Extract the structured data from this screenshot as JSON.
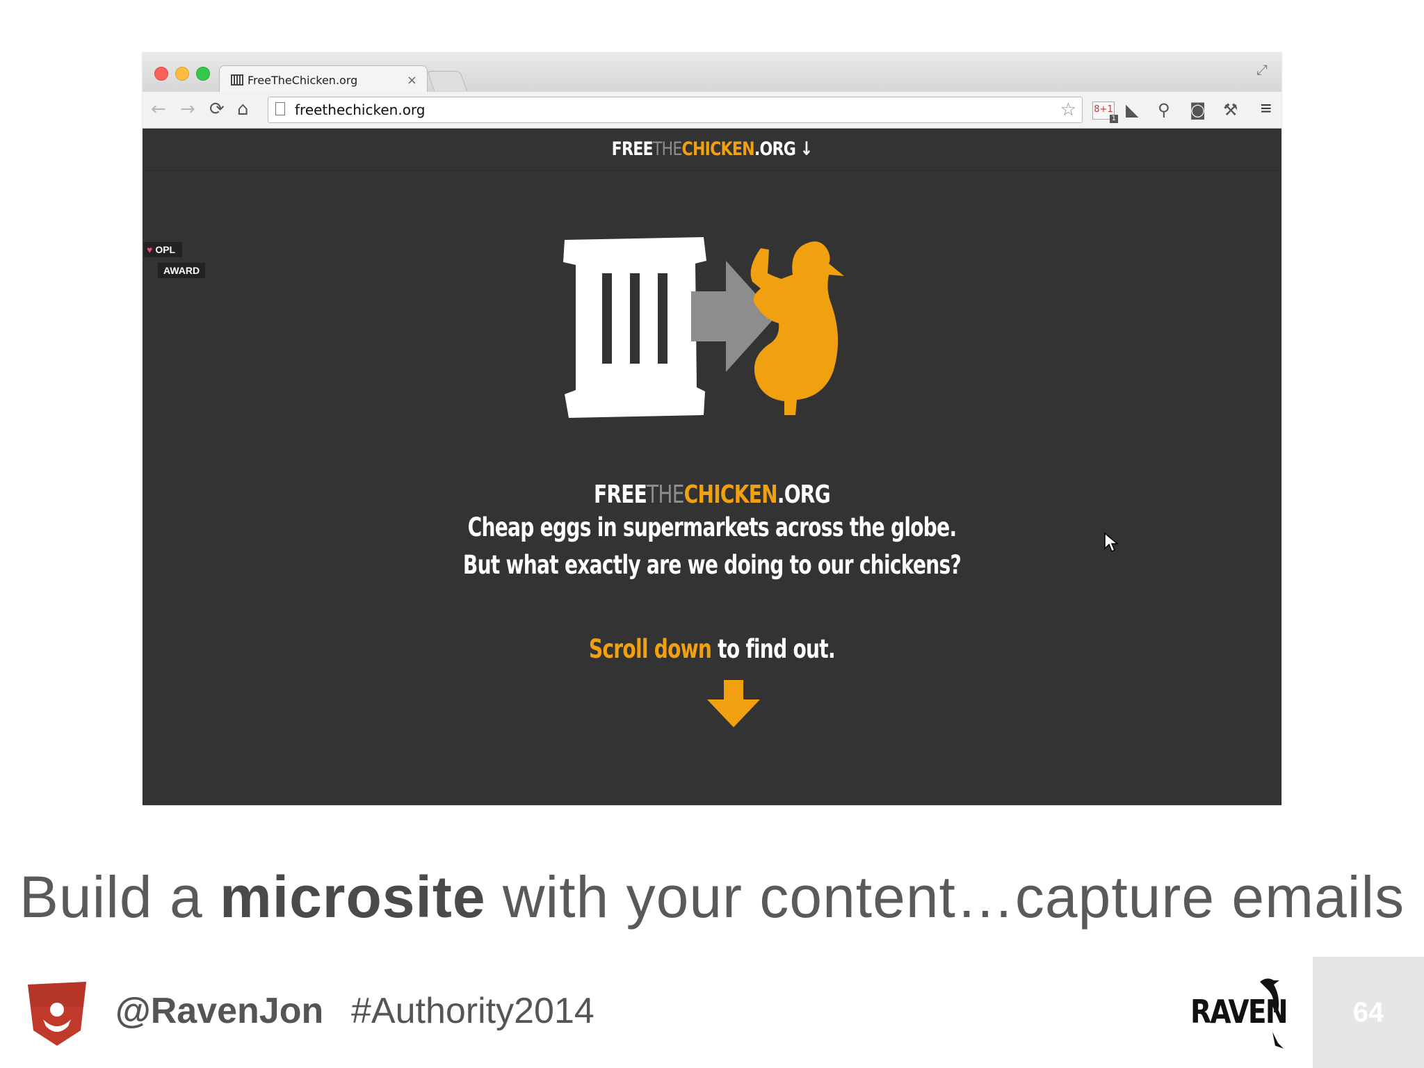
{
  "browser": {
    "tab_title": "FreeTheChicken.org",
    "tab_close": "×",
    "url": "freethechicken.org",
    "icons": [
      "back-icon",
      "forward-icon",
      "reload-icon",
      "home-icon",
      "page-icon",
      "star-icon",
      "google-plus-icon",
      "extension-icons",
      "menu-icon",
      "fullscreen-icon"
    ],
    "gplus_label": "8+1",
    "gplus_badge": "1"
  },
  "site": {
    "header_logo": {
      "free": "FREE",
      "the": "THE",
      "chicken": "CHICKEN",
      "org": ".ORG",
      "arrow": "↓"
    },
    "award": {
      "line1": "OPL",
      "line2": "AWARD"
    },
    "hero_logo": {
      "free": "FREE",
      "the": "THE",
      "chicken": "CHICKEN",
      "org": ".ORG"
    },
    "tagline_1": "Cheap eggs in supermarkets across the globe.",
    "tagline_2": "But what exactly are we doing to our chickens?",
    "scroll_emphasis": "Scroll down",
    "scroll_rest": " to find out.",
    "colors": {
      "background": "#333333",
      "accent": "#f1a00f",
      "arrow_gray": "#8d8d8d"
    }
  },
  "slide": {
    "caption_pre": "Build a ",
    "caption_bold": "microsite",
    "caption_post": " with your content…capture emails",
    "handle": "@RavenJon",
    "hashtag": "#Authority2014",
    "brand": "RAVEN",
    "page_number": "64"
  }
}
